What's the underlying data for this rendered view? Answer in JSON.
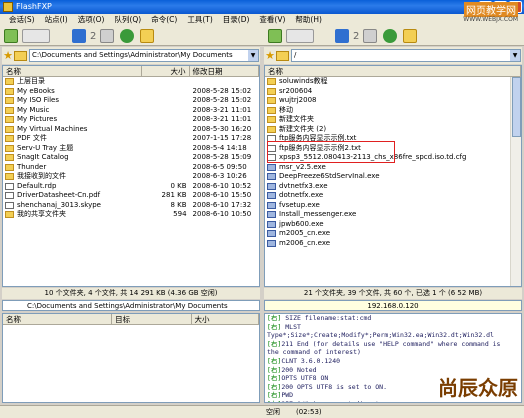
{
  "window": {
    "title": "FlashFXP"
  },
  "menu": [
    "会话(S)",
    "站点(I)",
    "选项(O)",
    "队列(Q)",
    "命令(C)",
    "工具(T)",
    "目录(D)",
    "查看(V)",
    "帮助(H)"
  ],
  "left": {
    "path": "C:\\Documents and Settings\\Administrator\\My Documents",
    "columns": [
      "名称",
      "大小",
      "修改日期"
    ],
    "items": [
      {
        "name": "上层目录",
        "size": "",
        "date": "",
        "type": "up"
      },
      {
        "name": "My eBooks",
        "size": "",
        "date": "2008-5-28 15:02",
        "type": "folder"
      },
      {
        "name": "My ISO Files",
        "size": "",
        "date": "2008-5-28 15:02",
        "type": "folder"
      },
      {
        "name": "My Music",
        "size": "",
        "date": "2008-3-21 11:01",
        "type": "folder"
      },
      {
        "name": "My Pictures",
        "size": "",
        "date": "2008-3-21 11:01",
        "type": "folder"
      },
      {
        "name": "My Virtual Machines",
        "size": "",
        "date": "2008-5-30 16:20",
        "type": "folder"
      },
      {
        "name": "PDF 文件",
        "size": "",
        "date": "2007-1-15 17:28",
        "type": "folder"
      },
      {
        "name": "Serv-U Tray 主题",
        "size": "",
        "date": "2008-5-4 14:18",
        "type": "folder"
      },
      {
        "name": "SnagIt Catalog",
        "size": "",
        "date": "2008-5-28 15:09",
        "type": "folder"
      },
      {
        "name": "Thunder",
        "size": "",
        "date": "2008-6-5 09:50",
        "type": "folder"
      },
      {
        "name": "我接收到的文件",
        "size": "",
        "date": "2008-6-3 10:26",
        "type": "folder"
      },
      {
        "name": "Default.rdp",
        "size": "0 KB",
        "date": "2008-6-10 10:52",
        "type": "file"
      },
      {
        "name": "DriverDatasheet-Cn.pdf",
        "size": "281 KB",
        "date": "2008-6-10 15:50",
        "type": "file"
      },
      {
        "name": "shenchanaj_3013.skype",
        "size": "8 KB",
        "date": "2008-6-10 17:32",
        "type": "file"
      },
      {
        "name": "我的共享文件夹",
        "size": "594",
        "date": "2008-6-10 10:50",
        "type": "folder"
      }
    ],
    "status": "10 个文件夹, 4 个文件, 共 14 291 KB (4.36 GB 空闲)",
    "queue_path": "C:\\Documents and Settings\\Administrator\\My Documents",
    "queue_columns": [
      "名称",
      "目标",
      "大小"
    ]
  },
  "right": {
    "path": "/",
    "columns": [
      "名称"
    ],
    "items": [
      {
        "name": "soluwinds教程",
        "type": "folder"
      },
      {
        "name": "sr200604",
        "type": "folder"
      },
      {
        "name": "wujtrj2008",
        "type": "folder"
      },
      {
        "name": "移动",
        "type": "folder"
      },
      {
        "name": "新建文件夹",
        "type": "folder"
      },
      {
        "name": "新建文件夹 (2)",
        "type": "folder"
      },
      {
        "name": "ftp服务内容显示示例.txt",
        "type": "file"
      },
      {
        "name": "ftp服务内容显示示例2.txt",
        "type": "file"
      },
      {
        "name": "xpsp3_5512.080413-2113_chs_x86fre_spcd.iso.td.cfg",
        "type": "file"
      },
      {
        "name": "msr_v2.5.exe",
        "type": "exe"
      },
      {
        "name": "DeepFreeze6StdServInal.exe",
        "type": "exe"
      },
      {
        "name": "dvtnetfx3.exe",
        "type": "exe"
      },
      {
        "name": "dotnetfx.exe",
        "type": "exe"
      },
      {
        "name": "fvsetup.exe",
        "type": "exe"
      },
      {
        "name": "Install_messenger.exe",
        "type": "exe"
      },
      {
        "name": "jpwb600.exe",
        "type": "exe"
      },
      {
        "name": "m2005_cn.exe",
        "type": "exe"
      },
      {
        "name": "m2006_cn.exe",
        "type": "exe"
      }
    ],
    "status": "21 个文件夹, 39 个文件, 共 60 个, 已选 1 个 (6 52 MB)",
    "address": "192.168.0.120",
    "log": [
      {
        "k": "[右]",
        "t": "    SIZE filename:stat:cmd"
      },
      {
        "k": "[右]",
        "t": "    MLST"
      },
      {
        "k": "",
        "t": "Type*;Size*;Create;Modify*;Perm;Win32.ea;Win32.dt;Win32.dl"
      },
      {
        "k": "[右]",
        "t": "211 End (for details use \"HELP command\" where command is"
      },
      {
        "k": "",
        "t": "the command of interest)"
      },
      {
        "k": "[右]",
        "t": "CLNT 3.6.0.1240"
      },
      {
        "k": "[右]",
        "t": "200 Noted"
      },
      {
        "k": "[右]",
        "t": "OPTS UTF8 ON"
      },
      {
        "k": "[右]",
        "t": "200 OPTS UTF8 is set to ON."
      },
      {
        "k": "[右]",
        "t": "PWD"
      },
      {
        "k": "[右]",
        "t": "257 \"/\" is current directory."
      }
    ]
  },
  "bottom": {
    "label": "空闲",
    "time": "(02:53)"
  },
  "watermark": {
    "top": "网页教学网",
    "url": "WWW.WEBJX.COM",
    "brand": "尚辰众原"
  }
}
